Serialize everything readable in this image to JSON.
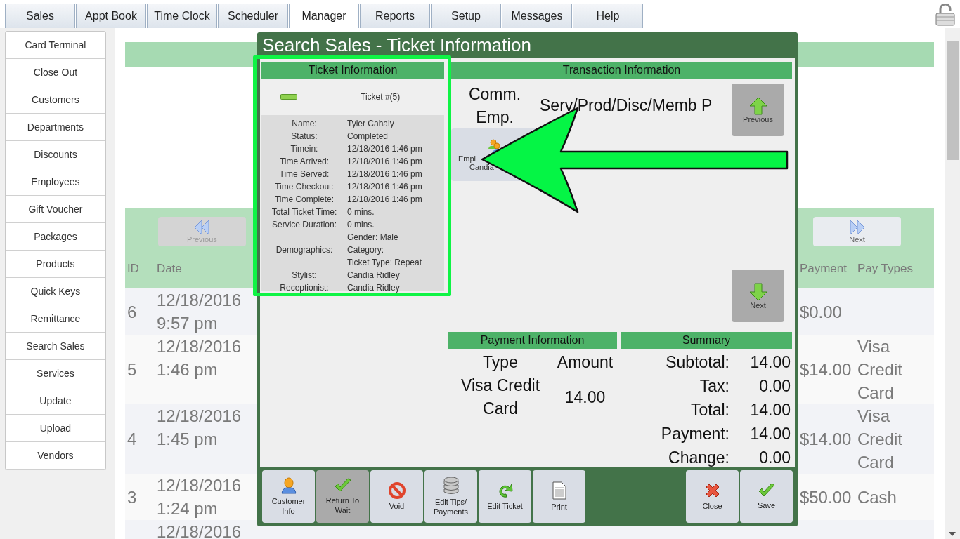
{
  "nav_tabs": [
    {
      "label": "Sales",
      "selected": false
    },
    {
      "label": "Appt Book",
      "selected": false
    },
    {
      "label": "Time Clock",
      "selected": false
    },
    {
      "label": "Scheduler",
      "selected": false
    },
    {
      "label": "Manager",
      "selected": true
    },
    {
      "label": "Reports",
      "selected": false
    },
    {
      "label": "Setup",
      "selected": false
    },
    {
      "label": "Messages",
      "selected": false
    },
    {
      "label": "Help",
      "selected": false
    }
  ],
  "sidebar": {
    "items": [
      {
        "label": "Card Terminal"
      },
      {
        "label": "Close Out"
      },
      {
        "label": "Customers"
      },
      {
        "label": "Departments"
      },
      {
        "label": "Discounts"
      },
      {
        "label": "Employees"
      },
      {
        "label": "Gift Voucher"
      },
      {
        "label": "Packages"
      },
      {
        "label": "Products"
      },
      {
        "label": "Quick Keys"
      },
      {
        "label": "Remittance"
      },
      {
        "label": "Search Sales"
      },
      {
        "label": "Services"
      },
      {
        "label": "Update"
      },
      {
        "label": "Upload"
      },
      {
        "label": "Vendors"
      }
    ]
  },
  "sales_table": {
    "prev_button": {
      "label": "Previous",
      "disabled": true
    },
    "next_button": {
      "label": "Next",
      "disabled": false
    },
    "columns": {
      "id": "ID",
      "date": "Date",
      "payment": "Payment",
      "pay_types": "Pay Types"
    },
    "rows": [
      {
        "id": "6",
        "date": "12/18/2016 9:57 pm",
        "payment": "$0.00"
      },
      {
        "id": "5",
        "date": "12/18/2016 1:46 pm",
        "payment": "$14.00",
        "pay_types": "Visa Credit Card"
      },
      {
        "id": "4",
        "date": "12/18/2016 1:45 pm",
        "payment": "$14.00",
        "pay_types": "Visa Credit Card"
      },
      {
        "id": "3",
        "date": "12/18/2016 1:24 pm",
        "payment": "$50.00",
        "pay_types": "Cash"
      },
      {
        "date": "12/18/2016"
      }
    ]
  },
  "dialog": {
    "title": "Search Sales - Ticket Information",
    "ticket_info": {
      "header": "Ticket Information",
      "ticket_number": "Ticket #(5)",
      "details": [
        {
          "label": "Name:",
          "lines": [
            "Tyler Cahaly"
          ]
        },
        {
          "label": "Status:",
          "lines": [
            "Completed"
          ]
        },
        {
          "label": "Timein:",
          "lines": [
            "12/18/2016 1:46 pm"
          ]
        },
        {
          "label": "Time Arrived:",
          "lines": [
            "12/18/2016 1:46 pm"
          ]
        },
        {
          "label": "Time Served:",
          "lines": [
            "12/18/2016 1:46 pm"
          ]
        },
        {
          "label": "Time Checkout:",
          "lines": [
            "12/18/2016 1:46 pm"
          ]
        },
        {
          "label": "Time Complete:",
          "lines": [
            "12/18/2016 1:46 pm"
          ]
        },
        {
          "label": "Total Ticket Time:",
          "lines": [
            "0 mins."
          ]
        },
        {
          "label": "Service Duration:",
          "lines": [
            "0 mins."
          ]
        },
        {
          "label": "Demographics:",
          "lines": [
            "Gender: Male",
            "Category:",
            "Ticket Type: Repeat"
          ]
        },
        {
          "label": "Stylist:",
          "lines": [
            "Candia Ridley"
          ]
        },
        {
          "label": "Receptionist:",
          "lines": [
            "Candia Ridley"
          ]
        }
      ]
    },
    "transaction_info": {
      "header": "Transaction Information",
      "comm_emp_header": "Comm. Emp.",
      "items_header": "Serv/Prod/Disc/Memb  P",
      "employee_card": {
        "lines": [
          "Empl",
          "Candia"
        ]
      },
      "prev_button": "Previous",
      "next_button": "Next"
    },
    "payment_info": {
      "header": "Payment Information",
      "columns": [
        "Type",
        "Amount"
      ],
      "rows": [
        {
          "type": "Visa Credit Card",
          "amount": "14.00"
        }
      ]
    },
    "summary": {
      "header": "Summary",
      "rows": [
        {
          "label": "Subtotal:",
          "value": "14.00"
        },
        {
          "label": "Tax:",
          "value": "0.00"
        },
        {
          "label": "Total:",
          "value": "14.00"
        },
        {
          "label": "Payment:",
          "value": "14.00"
        },
        {
          "label": "Change:",
          "value": "0.00"
        }
      ]
    },
    "toolbar": {
      "left": [
        {
          "kind": "customer",
          "label": "Customer Info",
          "disabled": false
        },
        {
          "kind": "check",
          "label": "Return To Wait",
          "disabled": true
        },
        {
          "kind": "void",
          "label": "Void",
          "disabled": false
        },
        {
          "kind": "database",
          "label": "Edit Tips/ Payments",
          "disabled": false
        },
        {
          "kind": "refresh",
          "label": "Edit Ticket",
          "disabled": false
        },
        {
          "kind": "document",
          "label": "Print",
          "disabled": false
        }
      ],
      "right": [
        {
          "kind": "close",
          "label": "Close",
          "disabled": false
        },
        {
          "kind": "check",
          "label": "Save",
          "disabled": false
        }
      ]
    }
  }
}
